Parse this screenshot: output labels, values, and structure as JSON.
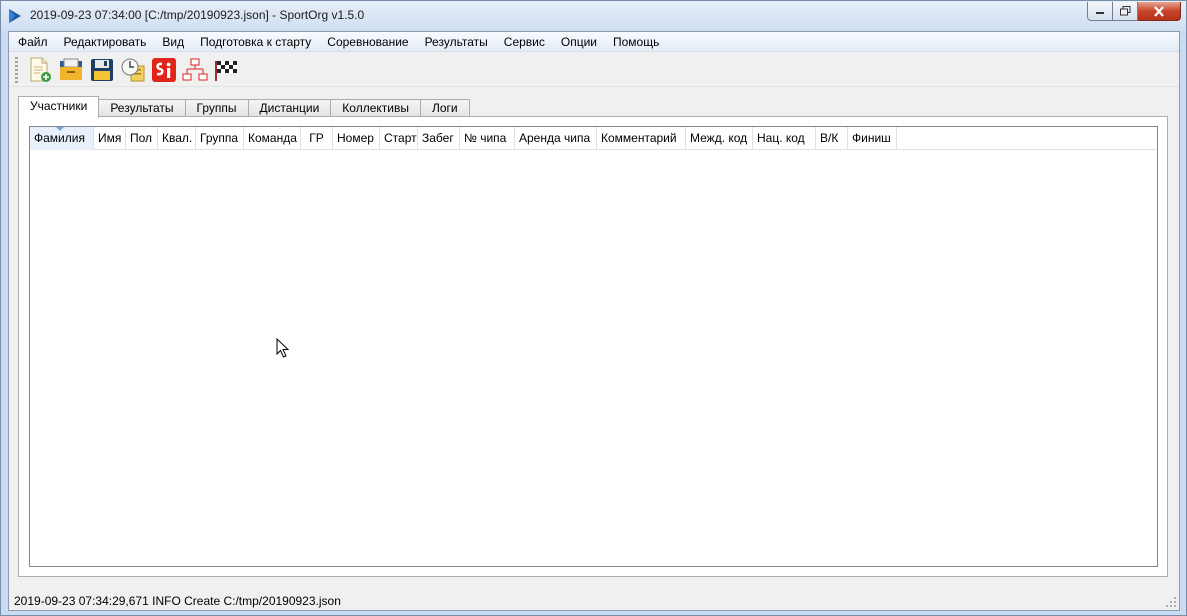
{
  "window": {
    "title": "2019-09-23 07:34:00 [C:/tmp/20190923.json] - SportOrg v1.5.0"
  },
  "menu": [
    "Файл",
    "Редактировать",
    "Вид",
    "Подготовка к старту",
    "Соревнование",
    "Результаты",
    "Сервис",
    "Опции",
    "Помощь"
  ],
  "toolbar": {
    "icons": [
      "new-file-icon",
      "open-folder-icon",
      "save-icon",
      "clock-icon",
      "si-reader-icon",
      "network-icon",
      "finish-flag-icon"
    ]
  },
  "tabs": [
    "Участники",
    "Результаты",
    "Группы",
    "Дистанции",
    "Коллективы",
    "Логи"
  ],
  "active_tab": "Участники",
  "table": {
    "columns": [
      "Фамилия",
      "Имя",
      "Пол",
      "Квал.",
      "Группа",
      "Команда",
      "ГР",
      "Номер",
      "Старт",
      "Забег",
      "№ чипа",
      "Аренда чипа",
      "Комментарий",
      "Межд. код",
      "Нац. код",
      "В/К",
      "Финиш"
    ],
    "sorted_column": "Фамилия",
    "rows": []
  },
  "status": "2019-09-23 07:34:29,671 INFO Create C:/tmp/20190923.json",
  "colors": {
    "titlebar": "#cfdff2",
    "client": "#f0f0f0",
    "close_button": "#c7452a"
  }
}
